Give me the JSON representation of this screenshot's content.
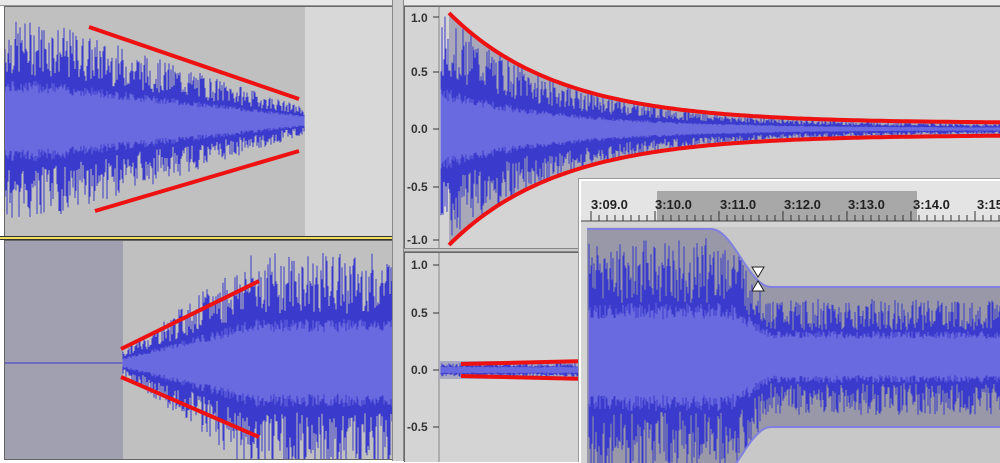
{
  "panels": {
    "fade_out": {
      "label": ""
    },
    "fade_in": {
      "label": ""
    }
  },
  "exp_axis": {
    "labels": [
      "1.0",
      "0.5",
      "0.0",
      "-0.5",
      "-1.0"
    ]
  },
  "low_axis": {
    "labels": [
      "1.0",
      "0.5",
      "0.0",
      "-0.5"
    ]
  },
  "timeline": {
    "labels": [
      "3:09.0",
      "3:10.0",
      "3:11.0",
      "3:12.0",
      "3:13.0",
      "3:14.0",
      "3:15"
    ]
  },
  "colors": {
    "waveform": "#3a3acc",
    "waveform_core": "#6a6ae0",
    "envelope": "#ee1111",
    "envelope_handle": "#ffffff",
    "selection": "#9a9ab0"
  }
}
